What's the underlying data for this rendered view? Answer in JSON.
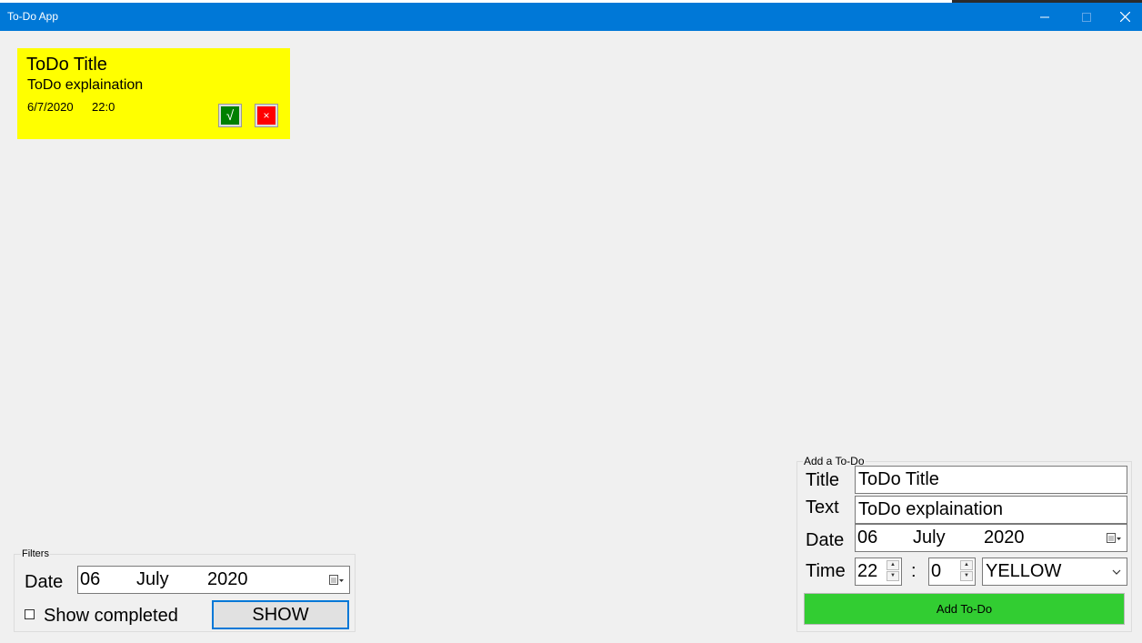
{
  "window": {
    "title": "To-Do App"
  },
  "todo": {
    "title": "ToDo Title",
    "text": "ToDo explaination",
    "date": "6/7/2020",
    "time": "22:0",
    "complete_symbol": "√",
    "delete_symbol": "×",
    "color": "#ffff00"
  },
  "filters": {
    "legend": "Filters",
    "date_label": "Date",
    "date_day": "06",
    "date_month": "July",
    "date_year": "2020",
    "show_completed_label": "Show completed",
    "show_completed_checked": false,
    "show_button": "SHOW"
  },
  "add": {
    "legend": "Add a To-Do",
    "title_label": "Title",
    "title_value": "ToDo Title",
    "text_label": "Text",
    "text_value": "ToDo explaination",
    "date_label": "Date",
    "date_day": "06",
    "date_month": "July",
    "date_year": "2020",
    "time_label": "Time",
    "hour": "22",
    "time_sep": ":",
    "minute": "0",
    "color_value": "YELLOW",
    "add_button": "Add To-Do",
    "add_button_color": "#32cd32"
  },
  "colors": {
    "titlebar": "#0078d7",
    "background": "#f0f0f0"
  }
}
